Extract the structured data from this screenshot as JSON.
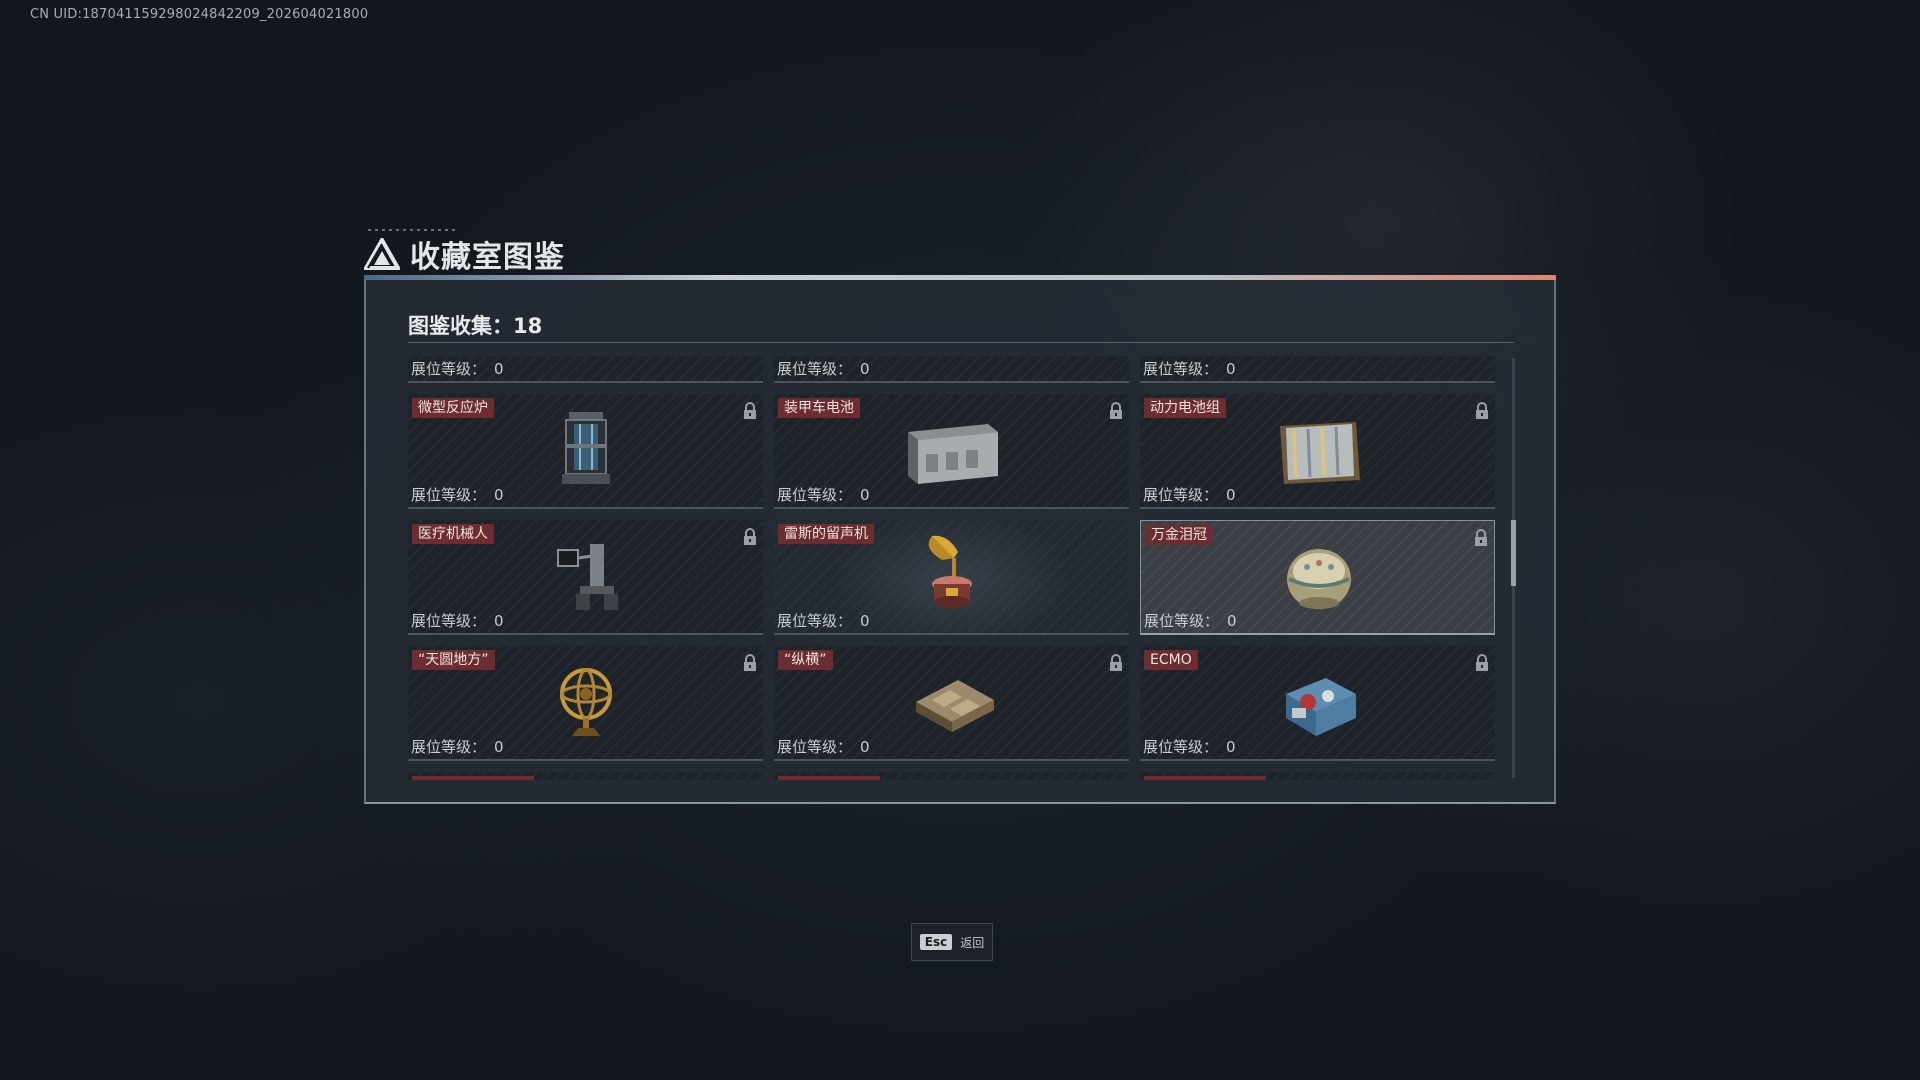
{
  "uid": "CN UID:18704115929802484​2209_202604021800",
  "title": "收藏室图鉴",
  "collection": {
    "label": "图鉴收集：",
    "count": "18"
  },
  "level_label": "展位等级：",
  "cards": [
    {
      "name": "",
      "level": "0",
      "locked": false,
      "partial": "top"
    },
    {
      "name": "",
      "level": "0",
      "locked": false,
      "partial": "top"
    },
    {
      "name": "",
      "level": "0",
      "locked": false,
      "partial": "top"
    },
    {
      "name": "微型反应炉",
      "level": "0",
      "locked": true,
      "icon": "reactor-icon"
    },
    {
      "name": "装甲车电池",
      "level": "0",
      "locked": true,
      "icon": "battery-icon"
    },
    {
      "name": "动力电池组",
      "level": "0",
      "locked": true,
      "icon": "battery-pack-icon"
    },
    {
      "name": "医疗机械人",
      "level": "0",
      "locked": true,
      "icon": "medical-robot-icon"
    },
    {
      "name": "雷斯的留声机",
      "level": "0",
      "locked": false,
      "icon": "gramophone-icon"
    },
    {
      "name": "万金泪冠",
      "level": "0",
      "locked": true,
      "icon": "crown-icon"
    },
    {
      "name": "“天圆地方”",
      "level": "0",
      "locked": true,
      "icon": "armillary-sphere-icon"
    },
    {
      "name": "“纵横”",
      "level": "0",
      "locked": true,
      "icon": "chessboard-icon"
    },
    {
      "name": "ECMO",
      "level": "0",
      "locked": true,
      "icon": "ecmo-icon"
    }
  ],
  "footer": {
    "key": "Esc",
    "label": "返回"
  },
  "colors": {
    "tag_bg": "#6b2d2f",
    "accent_line": "#c8ced4",
    "accent_end": "#e0866e"
  }
}
